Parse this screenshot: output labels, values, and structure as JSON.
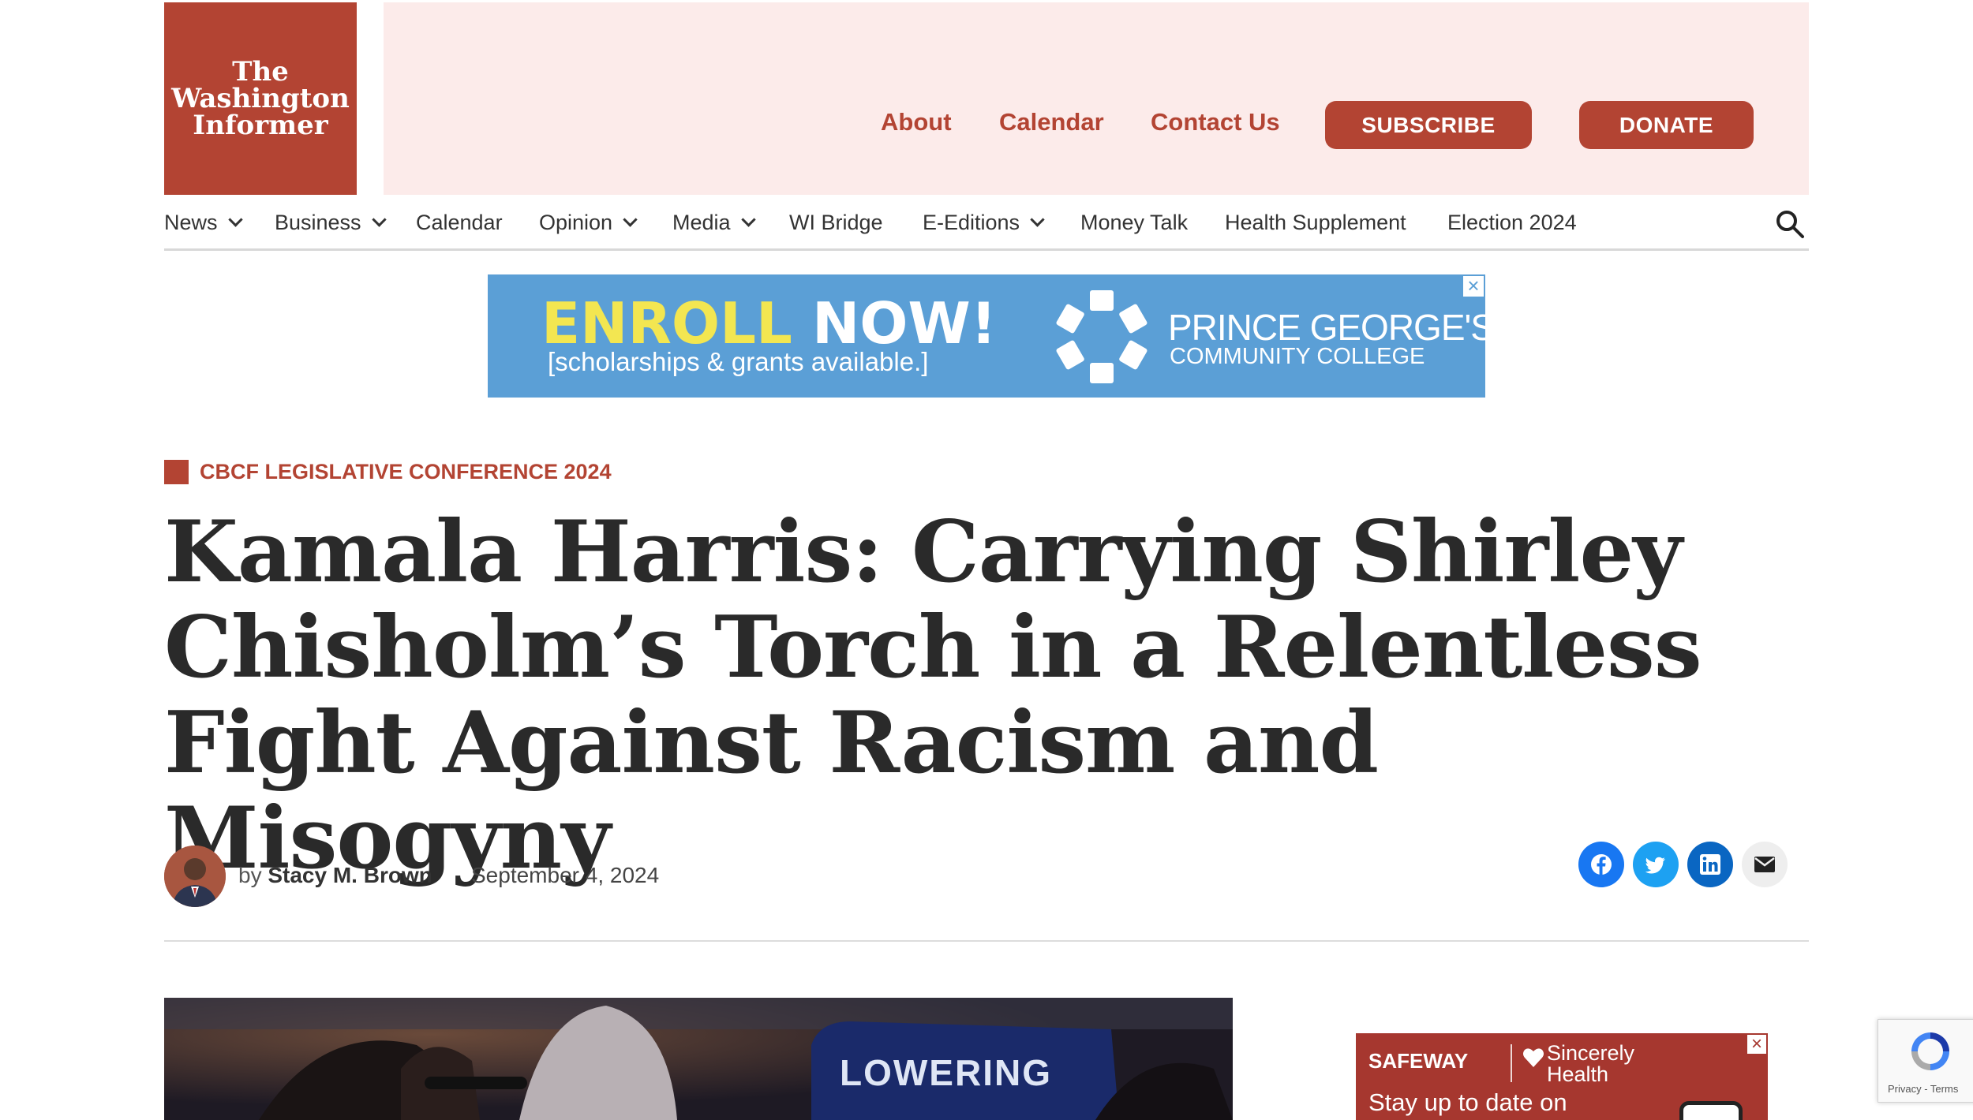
{
  "site": {
    "logo_text": "The\nWashington\nInformer"
  },
  "header": {
    "links": [
      "About",
      "Calendar",
      "Contact Us"
    ],
    "subscribe_label": "SUBSCRIBE",
    "donate_label": "DONATE"
  },
  "nav": {
    "items": [
      {
        "label": "News",
        "dropdown": true
      },
      {
        "label": "Business",
        "dropdown": true
      },
      {
        "label": "Calendar",
        "dropdown": false
      },
      {
        "label": "Opinion",
        "dropdown": true
      },
      {
        "label": "Media",
        "dropdown": true
      },
      {
        "label": "WI Bridge",
        "dropdown": false
      },
      {
        "label": "E-Editions",
        "dropdown": true
      },
      {
        "label": "Money Talk",
        "dropdown": false
      },
      {
        "label": "Health Supplement",
        "dropdown": false
      },
      {
        "label": "Election 2024",
        "dropdown": false
      }
    ]
  },
  "ad_top": {
    "enroll_yellow": "ENROLL",
    "enroll_white": "NOW!",
    "subtext": "[scholarships & grants available.]",
    "college_name": "PRINCE GEORGE'S",
    "college_sub": "COMMUNITY COLLEGE",
    "close": "×"
  },
  "article": {
    "kicker": "CBCF LEGISLATIVE CONFERENCE 2024",
    "headline": "Kamala Harris: Carrying Shirley Chisholm’s Torch in a Relentless Fight Against Racism and Misogyny",
    "byline_prefix": "by",
    "author": "Stacy M. Brown",
    "date": "September 4, 2024",
    "hero_sign_text": "LOWERING"
  },
  "share": [
    {
      "name": "facebook",
      "color": "#1877f2"
    },
    {
      "name": "twitter",
      "color": "#1da1f2"
    },
    {
      "name": "linkedin",
      "color": "#0a66c2"
    },
    {
      "name": "email",
      "color": "#eeeeee"
    }
  ],
  "ad_side": {
    "brand": "SAFEWAY",
    "partner": "Sincerely\nHealth",
    "tagline": "Stay up to date on",
    "close": "×"
  },
  "recaptcha": {
    "text": "Privacy - Terms"
  },
  "colors": {
    "brand": "#b34433",
    "band": "#fcebea",
    "ad_blue": "#5b9fd6"
  }
}
